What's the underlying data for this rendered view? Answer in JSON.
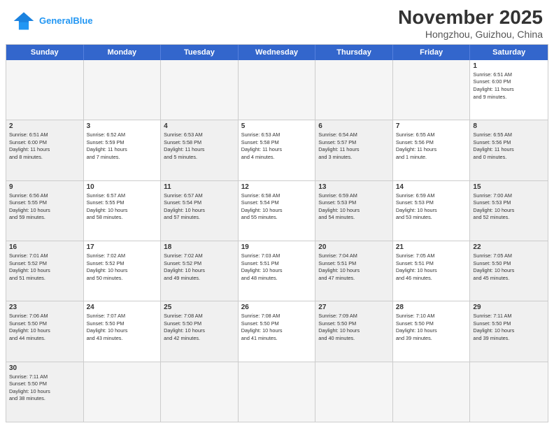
{
  "header": {
    "logo_general": "General",
    "logo_blue": "Blue",
    "month_title": "November 2025",
    "location": "Hongzhou, Guizhou, China"
  },
  "weekdays": [
    "Sunday",
    "Monday",
    "Tuesday",
    "Wednesday",
    "Thursday",
    "Friday",
    "Saturday"
  ],
  "rows": [
    [
      {
        "day": "",
        "empty": true
      },
      {
        "day": "",
        "empty": true
      },
      {
        "day": "",
        "empty": true
      },
      {
        "day": "",
        "empty": true
      },
      {
        "day": "",
        "empty": true
      },
      {
        "day": "",
        "empty": true
      },
      {
        "day": "1",
        "info": "Sunrise: 6:51 AM\nSunset: 6:00 PM\nDaylight: 11 hours\nand 9 minutes."
      }
    ],
    [
      {
        "day": "2",
        "info": "Sunrise: 6:51 AM\nSunset: 6:00 PM\nDaylight: 11 hours\nand 8 minutes.",
        "gray": true
      },
      {
        "day": "3",
        "info": "Sunrise: 6:52 AM\nSunset: 5:59 PM\nDaylight: 11 hours\nand 7 minutes."
      },
      {
        "day": "4",
        "info": "Sunrise: 6:53 AM\nSunset: 5:58 PM\nDaylight: 11 hours\nand 5 minutes.",
        "gray": true
      },
      {
        "day": "5",
        "info": "Sunrise: 6:53 AM\nSunset: 5:58 PM\nDaylight: 11 hours\nand 4 minutes."
      },
      {
        "day": "6",
        "info": "Sunrise: 6:54 AM\nSunset: 5:57 PM\nDaylight: 11 hours\nand 3 minutes.",
        "gray": true
      },
      {
        "day": "7",
        "info": "Sunrise: 6:55 AM\nSunset: 5:56 PM\nDaylight: 11 hours\nand 1 minute."
      },
      {
        "day": "8",
        "info": "Sunrise: 6:55 AM\nSunset: 5:56 PM\nDaylight: 11 hours\nand 0 minutes.",
        "gray": true
      }
    ],
    [
      {
        "day": "9",
        "info": "Sunrise: 6:56 AM\nSunset: 5:55 PM\nDaylight: 10 hours\nand 59 minutes.",
        "gray": true
      },
      {
        "day": "10",
        "info": "Sunrise: 6:57 AM\nSunset: 5:55 PM\nDaylight: 10 hours\nand 58 minutes."
      },
      {
        "day": "11",
        "info": "Sunrise: 6:57 AM\nSunset: 5:54 PM\nDaylight: 10 hours\nand 57 minutes.",
        "gray": true
      },
      {
        "day": "12",
        "info": "Sunrise: 6:58 AM\nSunset: 5:54 PM\nDaylight: 10 hours\nand 55 minutes."
      },
      {
        "day": "13",
        "info": "Sunrise: 6:59 AM\nSunset: 5:53 PM\nDaylight: 10 hours\nand 54 minutes.",
        "gray": true
      },
      {
        "day": "14",
        "info": "Sunrise: 6:59 AM\nSunset: 5:53 PM\nDaylight: 10 hours\nand 53 minutes."
      },
      {
        "day": "15",
        "info": "Sunrise: 7:00 AM\nSunset: 5:53 PM\nDaylight: 10 hours\nand 52 minutes.",
        "gray": true
      }
    ],
    [
      {
        "day": "16",
        "info": "Sunrise: 7:01 AM\nSunset: 5:52 PM\nDaylight: 10 hours\nand 51 minutes.",
        "gray": true
      },
      {
        "day": "17",
        "info": "Sunrise: 7:02 AM\nSunset: 5:52 PM\nDaylight: 10 hours\nand 50 minutes."
      },
      {
        "day": "18",
        "info": "Sunrise: 7:02 AM\nSunset: 5:52 PM\nDaylight: 10 hours\nand 49 minutes.",
        "gray": true
      },
      {
        "day": "19",
        "info": "Sunrise: 7:03 AM\nSunset: 5:51 PM\nDaylight: 10 hours\nand 48 minutes."
      },
      {
        "day": "20",
        "info": "Sunrise: 7:04 AM\nSunset: 5:51 PM\nDaylight: 10 hours\nand 47 minutes.",
        "gray": true
      },
      {
        "day": "21",
        "info": "Sunrise: 7:05 AM\nSunset: 5:51 PM\nDaylight: 10 hours\nand 46 minutes."
      },
      {
        "day": "22",
        "info": "Sunrise: 7:05 AM\nSunset: 5:50 PM\nDaylight: 10 hours\nand 45 minutes.",
        "gray": true
      }
    ],
    [
      {
        "day": "23",
        "info": "Sunrise: 7:06 AM\nSunset: 5:50 PM\nDaylight: 10 hours\nand 44 minutes.",
        "gray": true
      },
      {
        "day": "24",
        "info": "Sunrise: 7:07 AM\nSunset: 5:50 PM\nDaylight: 10 hours\nand 43 minutes."
      },
      {
        "day": "25",
        "info": "Sunrise: 7:08 AM\nSunset: 5:50 PM\nDaylight: 10 hours\nand 42 minutes.",
        "gray": true
      },
      {
        "day": "26",
        "info": "Sunrise: 7:08 AM\nSunset: 5:50 PM\nDaylight: 10 hours\nand 41 minutes."
      },
      {
        "day": "27",
        "info": "Sunrise: 7:09 AM\nSunset: 5:50 PM\nDaylight: 10 hours\nand 40 minutes.",
        "gray": true
      },
      {
        "day": "28",
        "info": "Sunrise: 7:10 AM\nSunset: 5:50 PM\nDaylight: 10 hours\nand 39 minutes."
      },
      {
        "day": "29",
        "info": "Sunrise: 7:11 AM\nSunset: 5:50 PM\nDaylight: 10 hours\nand 39 minutes.",
        "gray": true
      }
    ],
    [
      {
        "day": "30",
        "info": "Sunrise: 7:11 AM\nSunset: 5:50 PM\nDaylight: 10 hours\nand 38 minutes.",
        "gray": true
      },
      {
        "day": "",
        "empty": true
      },
      {
        "day": "",
        "empty": true
      },
      {
        "day": "",
        "empty": true
      },
      {
        "day": "",
        "empty": true
      },
      {
        "day": "",
        "empty": true
      },
      {
        "day": "",
        "empty": true
      }
    ]
  ]
}
